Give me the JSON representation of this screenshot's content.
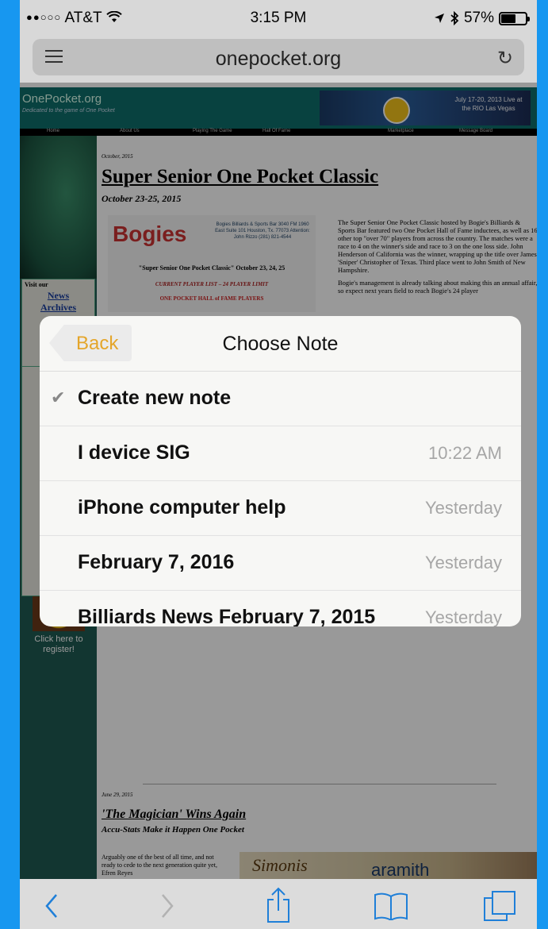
{
  "status_bar": {
    "carrier": "AT&T",
    "time": "3:15 PM",
    "battery": "57%"
  },
  "url_bar": {
    "url": "onepocket.org"
  },
  "webpage": {
    "site_title": "OnePocket.org",
    "site_subtitle": "Dedicated to the game of One Pocket",
    "banner_text": "July 17-20, 2013 Live at the RIO Las Vegas",
    "nav": [
      "Home",
      "About Us",
      "Playing The Game",
      "Hall Of Fame",
      "Marketplace",
      "Message Board"
    ],
    "left": {
      "visit_our": "Visit our",
      "news_link": "News",
      "archives_link": "Archives",
      "register": "Click here to register!"
    },
    "article1": {
      "date": "October, 2015",
      "headline": "Super Senior One Pocket Classic",
      "subhead": "October 23-25, 2015",
      "flyer_logo": "Bogies",
      "flyer_address": "Bogies Billiards & Sports Bar 3040 FM 1960 East Suite 101 Houston, Tx. 77073 Attention: John Rizzo (281) 821-4544",
      "flyer_title": "\"Super Senior One Pocket Classic\" October 23, 24, 25",
      "flyer_sub": "CURRENT PLAYER LIST – 24 PLAYER LIMIT",
      "flyer_sub2": "ONE POCKET HALL of FAME PLAYERS",
      "para1": "The Super Senior One Pocket Classic hosted by Bogie's Billiards & Sports Bar featured two One Pocket Hall of Fame inductees, as well as 16 other top \"over 70\" players from across the country. The matches were a race to 4 on the winner's side and race to 3 on the one loss side. John Henderson of California was the winner, wrapping up the title over James 'Sniper' Christopher of Texas. Third place went to John Smith of New Hampshire.",
      "para2": "Bogie's management is already talking about making this an annual affair, so expect next years field to reach Bogie's 24 player"
    },
    "article2": {
      "date": "June 29, 2015",
      "headline": "'The Magician' Wins Again",
      "subhead": "Accu-Stats Make it Happen One Pocket",
      "body": "Arguably one of the best of all time, and not ready to cede to the next generation quite yet, Efren Reyes",
      "photo_text1": "Simonis",
      "photo_text2": "aramith"
    }
  },
  "sheet": {
    "back_label": "Back",
    "title": "Choose Note",
    "rows": [
      {
        "name": "Create new note",
        "time": "",
        "selected": true
      },
      {
        "name": "I device SIG",
        "time": "10:22 AM"
      },
      {
        "name": "iPhone computer help",
        "time": "Yesterday"
      },
      {
        "name": "February 7, 2016",
        "time": "Yesterday"
      },
      {
        "name": "Billiards News February 7, 2015",
        "time": "Yesterday"
      }
    ]
  },
  "toolbar": {
    "icons": [
      "back-arrow-icon",
      "forward-arrow-icon",
      "share-icon",
      "bookmarks-icon",
      "tabs-icon"
    ]
  }
}
